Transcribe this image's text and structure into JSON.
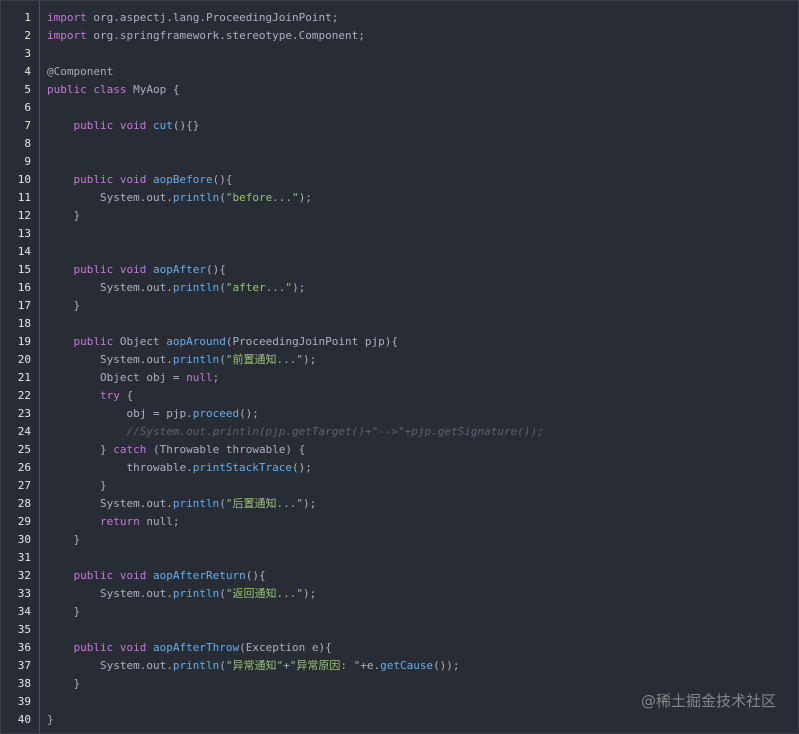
{
  "watermark": "@稀土掘金技术社区",
  "lines": [
    {
      "n": "1",
      "t": [
        [
          "k",
          "import"
        ],
        [
          "p",
          " org.aspectj.lang.ProceedingJoinPoint;"
        ]
      ]
    },
    {
      "n": "2",
      "t": [
        [
          "k",
          "import"
        ],
        [
          "p",
          " org.springframework.stereotype.Component;"
        ]
      ]
    },
    {
      "n": "3",
      "t": []
    },
    {
      "n": "4",
      "t": [
        [
          "a",
          "@Component"
        ]
      ]
    },
    {
      "n": "5",
      "t": [
        [
          "k",
          "public class"
        ],
        [
          "p",
          " MyAop {"
        ]
      ]
    },
    {
      "n": "6",
      "t": []
    },
    {
      "n": "7",
      "t": [
        [
          "p",
          "    "
        ],
        [
          "k",
          "public void"
        ],
        [
          "p",
          " "
        ],
        [
          "f",
          "cut"
        ],
        [
          "p",
          "(){}"
        ]
      ]
    },
    {
      "n": "8",
      "t": []
    },
    {
      "n": "9",
      "t": []
    },
    {
      "n": "10",
      "t": [
        [
          "p",
          "    "
        ],
        [
          "k",
          "public void"
        ],
        [
          "p",
          " "
        ],
        [
          "f",
          "aopBefore"
        ],
        [
          "p",
          "(){"
        ]
      ]
    },
    {
      "n": "11",
      "t": [
        [
          "p",
          "        System.out."
        ],
        [
          "f",
          "println"
        ],
        [
          "p",
          "("
        ],
        [
          "s",
          "\"before...\""
        ],
        [
          "p",
          ");"
        ]
      ]
    },
    {
      "n": "12",
      "t": [
        [
          "p",
          "    }"
        ]
      ]
    },
    {
      "n": "13",
      "t": []
    },
    {
      "n": "14",
      "t": []
    },
    {
      "n": "15",
      "t": [
        [
          "p",
          "    "
        ],
        [
          "k",
          "public void"
        ],
        [
          "p",
          " "
        ],
        [
          "f",
          "aopAfter"
        ],
        [
          "p",
          "(){"
        ]
      ]
    },
    {
      "n": "16",
      "t": [
        [
          "p",
          "        System.out."
        ],
        [
          "f",
          "println"
        ],
        [
          "p",
          "("
        ],
        [
          "s",
          "\"after...\""
        ],
        [
          "p",
          ");"
        ]
      ]
    },
    {
      "n": "17",
      "t": [
        [
          "p",
          "    }"
        ]
      ]
    },
    {
      "n": "18",
      "t": []
    },
    {
      "n": "19",
      "t": [
        [
          "p",
          "    "
        ],
        [
          "k",
          "public"
        ],
        [
          "p",
          " Object "
        ],
        [
          "f",
          "aopAround"
        ],
        [
          "p",
          "(ProceedingJoinPoint pjp){"
        ]
      ]
    },
    {
      "n": "20",
      "t": [
        [
          "p",
          "        System.out."
        ],
        [
          "f",
          "println"
        ],
        [
          "p",
          "("
        ],
        [
          "s",
          "\"前置通知...\""
        ],
        [
          "p",
          ");"
        ]
      ]
    },
    {
      "n": "21",
      "t": [
        [
          "p",
          "        Object obj = "
        ],
        [
          "k",
          "null"
        ],
        [
          "p",
          ";"
        ]
      ]
    },
    {
      "n": "22",
      "t": [
        [
          "p",
          "        "
        ],
        [
          "k",
          "try"
        ],
        [
          "p",
          " {"
        ]
      ]
    },
    {
      "n": "23",
      "t": [
        [
          "p",
          "            obj = pjp."
        ],
        [
          "f",
          "proceed"
        ],
        [
          "p",
          "();"
        ]
      ]
    },
    {
      "n": "24",
      "t": [
        [
          "p",
          "            "
        ],
        [
          "c",
          "//System.out.println(pjp.getTarget()+\"-->\"+pjp.getSignature());"
        ]
      ]
    },
    {
      "n": "25",
      "t": [
        [
          "p",
          "        } "
        ],
        [
          "k",
          "catch"
        ],
        [
          "p",
          " (Throwable throwable) {"
        ]
      ]
    },
    {
      "n": "26",
      "t": [
        [
          "p",
          "            throwable."
        ],
        [
          "f",
          "printStackTrace"
        ],
        [
          "p",
          "();"
        ]
      ]
    },
    {
      "n": "27",
      "t": [
        [
          "p",
          "        }"
        ]
      ]
    },
    {
      "n": "28",
      "t": [
        [
          "p",
          "        System.out."
        ],
        [
          "f",
          "println"
        ],
        [
          "p",
          "("
        ],
        [
          "s",
          "\"后置通知...\""
        ],
        [
          "p",
          ");"
        ]
      ]
    },
    {
      "n": "29",
      "t": [
        [
          "p",
          "        "
        ],
        [
          "k",
          "return"
        ],
        [
          "p",
          " null;"
        ]
      ]
    },
    {
      "n": "30",
      "t": [
        [
          "p",
          "    }"
        ]
      ]
    },
    {
      "n": "31",
      "t": []
    },
    {
      "n": "32",
      "t": [
        [
          "p",
          "    "
        ],
        [
          "k",
          "public void"
        ],
        [
          "p",
          " "
        ],
        [
          "f",
          "aopAfterReturn"
        ],
        [
          "p",
          "(){"
        ]
      ]
    },
    {
      "n": "33",
      "t": [
        [
          "p",
          "        System.out."
        ],
        [
          "f",
          "println"
        ],
        [
          "p",
          "("
        ],
        [
          "s",
          "\"返回通知...\""
        ],
        [
          "p",
          ");"
        ]
      ]
    },
    {
      "n": "34",
      "t": [
        [
          "p",
          "    }"
        ]
      ]
    },
    {
      "n": "35",
      "t": []
    },
    {
      "n": "36",
      "t": [
        [
          "p",
          "    "
        ],
        [
          "k",
          "public void"
        ],
        [
          "p",
          " "
        ],
        [
          "f",
          "aopAfterThrow"
        ],
        [
          "p",
          "(Exception e){"
        ]
      ]
    },
    {
      "n": "37",
      "t": [
        [
          "p",
          "        System.out."
        ],
        [
          "f",
          "println"
        ],
        [
          "p",
          "("
        ],
        [
          "s",
          "\"异常通知\""
        ],
        [
          "p",
          "+"
        ],
        [
          "s",
          "\"异常原因: \""
        ],
        [
          "p",
          "+e."
        ],
        [
          "f",
          "getCause"
        ],
        [
          "p",
          "());"
        ]
      ]
    },
    {
      "n": "38",
      "t": [
        [
          "p",
          "    }"
        ]
      ]
    },
    {
      "n": "39",
      "t": []
    },
    {
      "n": "40",
      "t": [
        [
          "p",
          "}"
        ]
      ]
    }
  ]
}
